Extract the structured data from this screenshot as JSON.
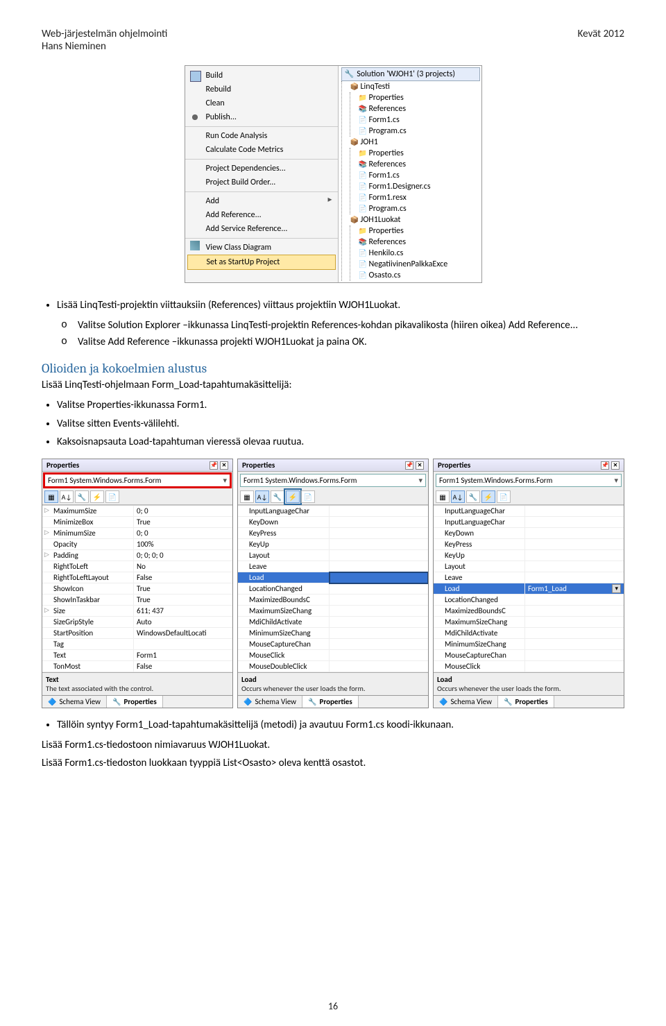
{
  "header": {
    "title_line1": "Web-järjestelmän ohjelmointi",
    "title_line2": "Hans Nieminen",
    "right": "Kevät 2012"
  },
  "contextMenu": {
    "items": [
      "Build",
      "Rebuild",
      "Clean",
      "Publish...",
      "Run Code Analysis",
      "Calculate Code Metrics",
      "Project Dependencies...",
      "Project Build Order...",
      "Add",
      "Add Reference...",
      "Add Service Reference...",
      "View Class Diagram",
      "Set as StartUp Project"
    ]
  },
  "treePanel": {
    "title": "Solution 'WJOH1' (3 projects)",
    "nodes": [
      {
        "label": "LinqTesti",
        "children": [
          "Properties",
          "References",
          "Form1.cs",
          "Program.cs"
        ]
      },
      {
        "label": "JOH1",
        "children": [
          "Properties",
          "References",
          "Form1.cs",
          "Form1.Designer.cs",
          "Form1.resx",
          "Program.cs"
        ]
      },
      {
        "label": "JOH1Luokat",
        "children": [
          "Properties",
          "References",
          "Henkilo.cs",
          "NegatiivinenPalkkaExce",
          "Osasto.cs"
        ]
      }
    ]
  },
  "instr": {
    "bullet1": "Lisää LinqTesti-projektin viittauksiin (References) viittaus projektiin WJOH1Luokat.",
    "sub1": "Valitse Solution Explorer –ikkunassa LinqTesti-projektin References-kohdan pikavalikosta (hiiren oikea) Add Reference...",
    "sub2": "Valitse Add Reference –ikkunassa projekti WJOH1Luokat ja paina OK."
  },
  "section": {
    "title": "Olioiden ja kokoelmien alustus",
    "para": "Lisää LinqTesti-ohjelmaan Form_Load-tapahtumakäsittelijä:",
    "bullets": [
      "Valitse Properties-ikkunassa Form1.",
      "Valitse sitten Events-välilehti.",
      "Kaksoisnapsauta Load-tapahtuman vieressä olevaa ruutua."
    ]
  },
  "propPanels": {
    "headTitle": "Properties",
    "selector": "Form1 System.Windows.Forms.Form",
    "toolbar": {
      "icons": [
        "▦",
        "A↓",
        "🔧",
        "⚡",
        "📄"
      ]
    },
    "panel1": {
      "rows": [
        [
          "MaximumSize",
          "0; 0"
        ],
        [
          "MinimizeBox",
          "True"
        ],
        [
          "MinimumSize",
          "0; 0"
        ],
        [
          "Opacity",
          "100%"
        ],
        [
          "Padding",
          "0; 0; 0; 0"
        ],
        [
          "RightToLeft",
          "No"
        ],
        [
          "RightToLeftLayout",
          "False"
        ],
        [
          "ShowIcon",
          "True"
        ],
        [
          "ShowInTaskbar",
          "True"
        ],
        [
          "Size",
          "611; 437"
        ],
        [
          "SizeGripStyle",
          "Auto"
        ],
        [
          "StartPosition",
          "WindowsDefaultLocati"
        ],
        [
          "Tag",
          ""
        ],
        [
          "Text",
          "Form1"
        ],
        [
          "TonMost",
          "False"
        ]
      ],
      "descTitle": "Text",
      "descBody": "The text associated with the control."
    },
    "panel2": {
      "rows": [
        [
          "InputLanguageChar",
          ""
        ],
        [
          "KeyDown",
          ""
        ],
        [
          "KeyPress",
          ""
        ],
        [
          "KeyUp",
          ""
        ],
        [
          "Layout",
          ""
        ],
        [
          "Leave",
          ""
        ],
        [
          "Load",
          ""
        ],
        [
          "LocationChanged",
          ""
        ],
        [
          "MaximizedBoundsC",
          ""
        ],
        [
          "MaximumSizeChang",
          ""
        ],
        [
          "MdiChildActivate",
          ""
        ],
        [
          "MinimumSizeChang",
          ""
        ],
        [
          "MouseCaptureChan",
          ""
        ],
        [
          "MouseClick",
          ""
        ],
        [
          "MouseDoubleClick",
          ""
        ]
      ],
      "descTitle": "Load",
      "descBody": "Occurs whenever the user loads the form."
    },
    "panel3": {
      "rows": [
        [
          "InputLanguageChar",
          ""
        ],
        [
          "InputLanguageChar",
          ""
        ],
        [
          "KeyDown",
          ""
        ],
        [
          "KeyPress",
          ""
        ],
        [
          "KeyUp",
          ""
        ],
        [
          "Layout",
          ""
        ],
        [
          "Leave",
          ""
        ],
        [
          "Load",
          "Form1_Load"
        ],
        [
          "LocationChanged",
          ""
        ],
        [
          "MaximizedBoundsC",
          ""
        ],
        [
          "MaximumSizeChang",
          ""
        ],
        [
          "MdiChildActivate",
          ""
        ],
        [
          "MinimumSizeChang",
          ""
        ],
        [
          "MouseCaptureChan",
          ""
        ],
        [
          "MouseClick",
          ""
        ]
      ],
      "descTitle": "Load",
      "descBody": "Occurs whenever the user loads the form."
    },
    "tabs": {
      "schema": "Schema View",
      "props": "Properties"
    }
  },
  "after": {
    "bullet": "Tällöin syntyy Form1_Load-tapahtumakäsittelijä (metodi) ja avautuu Form1.cs koodi-ikkunaan.",
    "para1": "Lisää Form1.cs-tiedostoon nimiavaruus WJOH1Luokat.",
    "para2": "Lisää Form1.cs-tiedoston luokkaan tyyppiä  List<Osasto> oleva kenttä osastot."
  },
  "pageNumber": "16"
}
